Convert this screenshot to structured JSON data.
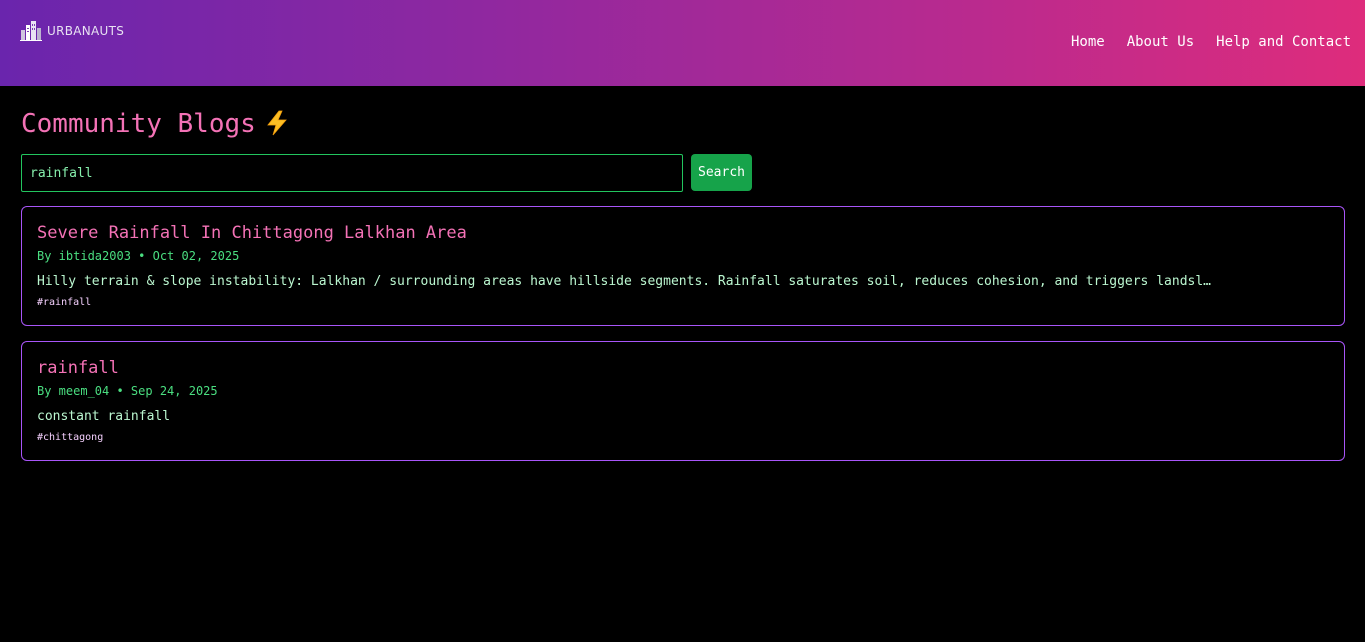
{
  "brand": {
    "name": "URBANAUTS",
    "logo_icon": "city-buildings-icon"
  },
  "nav": {
    "items": [
      {
        "label": "Home"
      },
      {
        "label": "About Us"
      },
      {
        "label": "Help and Contact"
      }
    ]
  },
  "page": {
    "title": "Community Blogs",
    "title_icon": "lightning-bolt-icon"
  },
  "search": {
    "value": "rainfall",
    "button_label": "Search"
  },
  "posts": [
    {
      "title": "Severe Rainfall In Chittagong Lalkhan Area",
      "meta": "By ibtida2003 • Oct 02, 2025",
      "excerpt": "Hilly terrain & slope instability: Lalkhan / surrounding areas have hillside segments. Rainfall saturates soil, reduces cohesion, and triggers landsl…",
      "tag": "#rainfall"
    },
    {
      "title": "rainfall",
      "meta": "By meem_04 • Sep 24, 2025",
      "excerpt": "constant rainfall",
      "tag": "#chittagong"
    }
  ],
  "colors": {
    "header_gradient_start": "#6a25ad",
    "header_gradient_end": "#de2c7c",
    "background": "#000000",
    "accent_pink": "#f472b6",
    "accent_green": "#4ade80",
    "card_border": "#a855f7",
    "search_button": "#16a34a"
  }
}
